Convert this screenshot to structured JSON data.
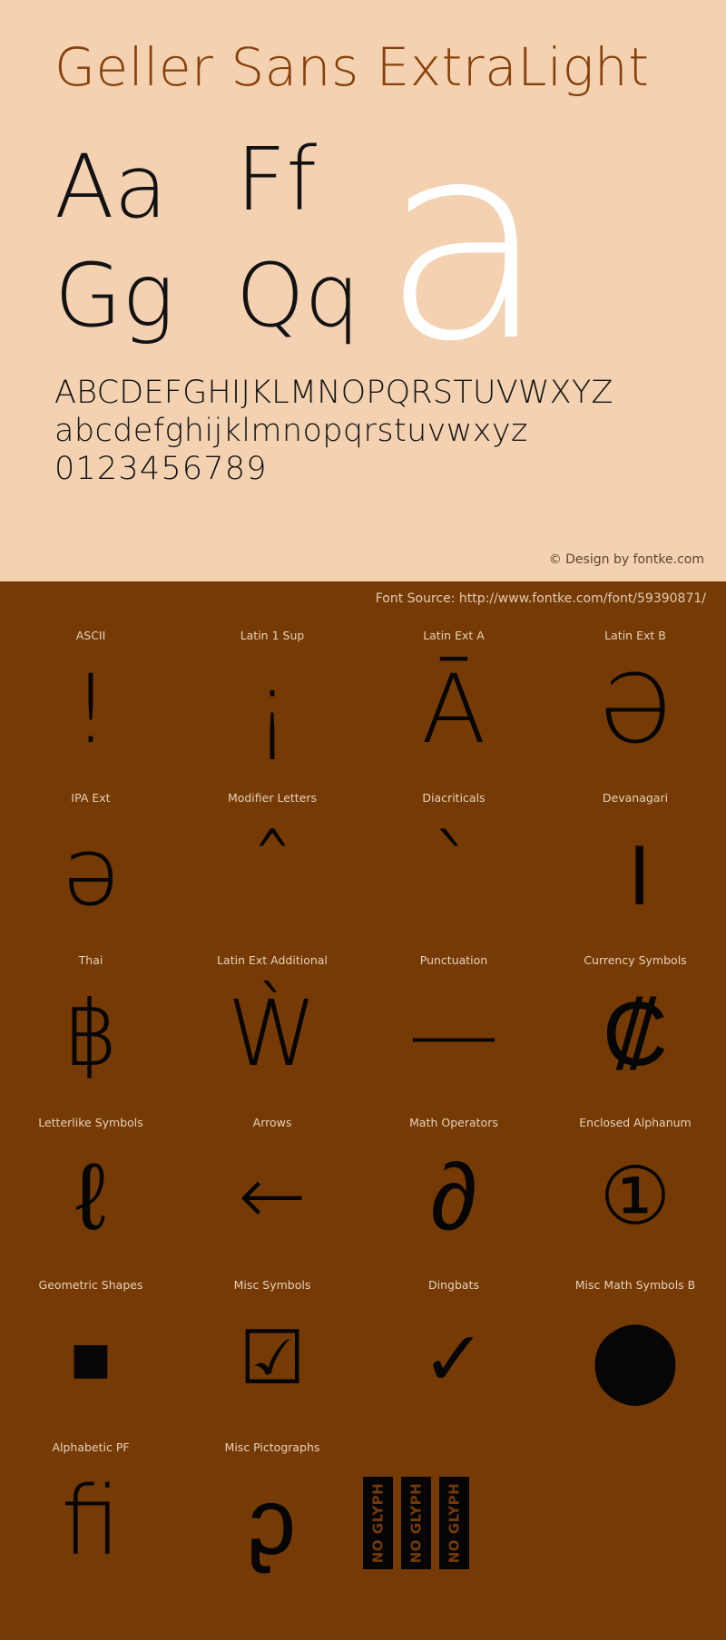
{
  "colors": {
    "hero_background": "#F3D1B1",
    "sheet_background": "#763B05",
    "title": "#87400A",
    "glyph": "#060606",
    "big_letter": "#FFFFFF",
    "label": "#E7D1BB",
    "credit": "#5E4630",
    "source": "#E4CBB3"
  },
  "hero": {
    "title": "Geller Sans ExtraLight",
    "letter_pairs": [
      "Aa",
      "Ff",
      "Gg",
      "Qq"
    ],
    "big_letter": "a",
    "uppercase": "ABCDEFGHIJKLMNOPQRSTUVWXYZ",
    "lowercase": "abcdefghijklmnopqrstuvwxyz",
    "digits": "0123456789",
    "credit": "© Design by fontke.com"
  },
  "sheet": {
    "source": "Font Source: http://www.fontke.com/font/59390871/",
    "rows": [
      [
        {
          "label": "ASCII",
          "glyph": "!",
          "glyph_class": "g-bang",
          "glyph_name": "exclamation-mark-glyph"
        },
        {
          "label": "Latin 1 Sup",
          "glyph": "¡",
          "glyph_class": "g-ibang",
          "glyph_name": "inverted-exclamation-glyph"
        },
        {
          "label": "Latin Ext A",
          "glyph": "Ā",
          "glyph_class": "g-amac",
          "glyph_name": "a-macron-glyph"
        },
        {
          "label": "Latin Ext B",
          "glyph": "Ə",
          "glyph_class": "g-schwa-c",
          "glyph_name": "capital-schwa-glyph"
        }
      ],
      [
        {
          "label": "IPA Ext",
          "glyph": "ə",
          "glyph_class": "g-schwa-l",
          "glyph_name": "schwa-glyph"
        },
        {
          "label": "Modifier Letters",
          "glyph": "ˆ",
          "glyph_class": "g-circ",
          "glyph_name": "modifier-circumflex-glyph"
        },
        {
          "label": "Diacriticals",
          "glyph": "ˋ",
          "glyph_class": "g-grave",
          "glyph_name": "grave-accent-glyph"
        },
        {
          "label": "Devanagari",
          "glyph": "।",
          "glyph_class": "g-danda",
          "glyph_name": "devanagari-danda-glyph"
        }
      ],
      [
        {
          "label": "Thai",
          "glyph": "฿",
          "glyph_class": "g-baht",
          "glyph_name": "thai-baht-glyph"
        },
        {
          "label": "Latin Ext Additional",
          "glyph": "Ẁ",
          "glyph_class": "g-wgrave",
          "glyph_name": "w-grave-glyph"
        },
        {
          "label": "Punctuation",
          "glyph": "—",
          "glyph_class": "g-emdash",
          "glyph_name": "em-dash-glyph"
        },
        {
          "label": "Currency Symbols",
          "glyph": "₡",
          "glyph_class": "g-colon",
          "glyph_name": "colon-currency-glyph"
        }
      ],
      [
        {
          "label": "Letterlike Symbols",
          "glyph": "ℓ",
          "glyph_class": "g-ell",
          "glyph_name": "script-small-l-glyph"
        },
        {
          "label": "Arrows",
          "glyph": "←",
          "glyph_class": "g-larrow",
          "glyph_name": "left-arrow-glyph"
        },
        {
          "label": "Math Operators",
          "glyph": "∂",
          "glyph_class": "g-partial",
          "glyph_name": "partial-differential-glyph"
        },
        {
          "label": "Enclosed Alphanum",
          "glyph": "①",
          "glyph_class": "g-circone",
          "glyph_name": "circled-digit-one-glyph"
        }
      ],
      [
        {
          "label": "Geometric Shapes",
          "glyph": "■",
          "glyph_class": "g-square",
          "glyph_name": "filled-square-glyph"
        },
        {
          "label": "Misc Symbols",
          "glyph": "☑",
          "glyph_class": "g-ballot",
          "glyph_name": "ballot-box-check-glyph"
        },
        {
          "label": "Dingbats",
          "glyph": "✓",
          "glyph_class": "g-check",
          "glyph_name": "check-mark-glyph"
        },
        {
          "label": "Misc Math Symbols B",
          "glyph": "⬤",
          "glyph_class": "g-disc",
          "glyph_name": "filled-circle-glyph"
        }
      ],
      [
        {
          "label": "Alphabetic PF",
          "glyph": "ﬁ",
          "glyph_class": "g-fi",
          "glyph_name": "fi-ligature-glyph"
        },
        {
          "label": "Misc Pictographs",
          "glyph": "ᶗ",
          "glyph_class": "g-oe",
          "glyph_name": "open-o-barred-glyph"
        },
        {
          "label": "",
          "glyph": "",
          "glyph_class": "",
          "glyph_name": "missing-glyph-boxes"
        },
        {
          "label": "",
          "glyph": "",
          "glyph_class": "",
          "glyph_name": "empty-cell"
        }
      ]
    ],
    "no_glyph_label": "NO GLYPH",
    "no_glyph_count": 3
  }
}
